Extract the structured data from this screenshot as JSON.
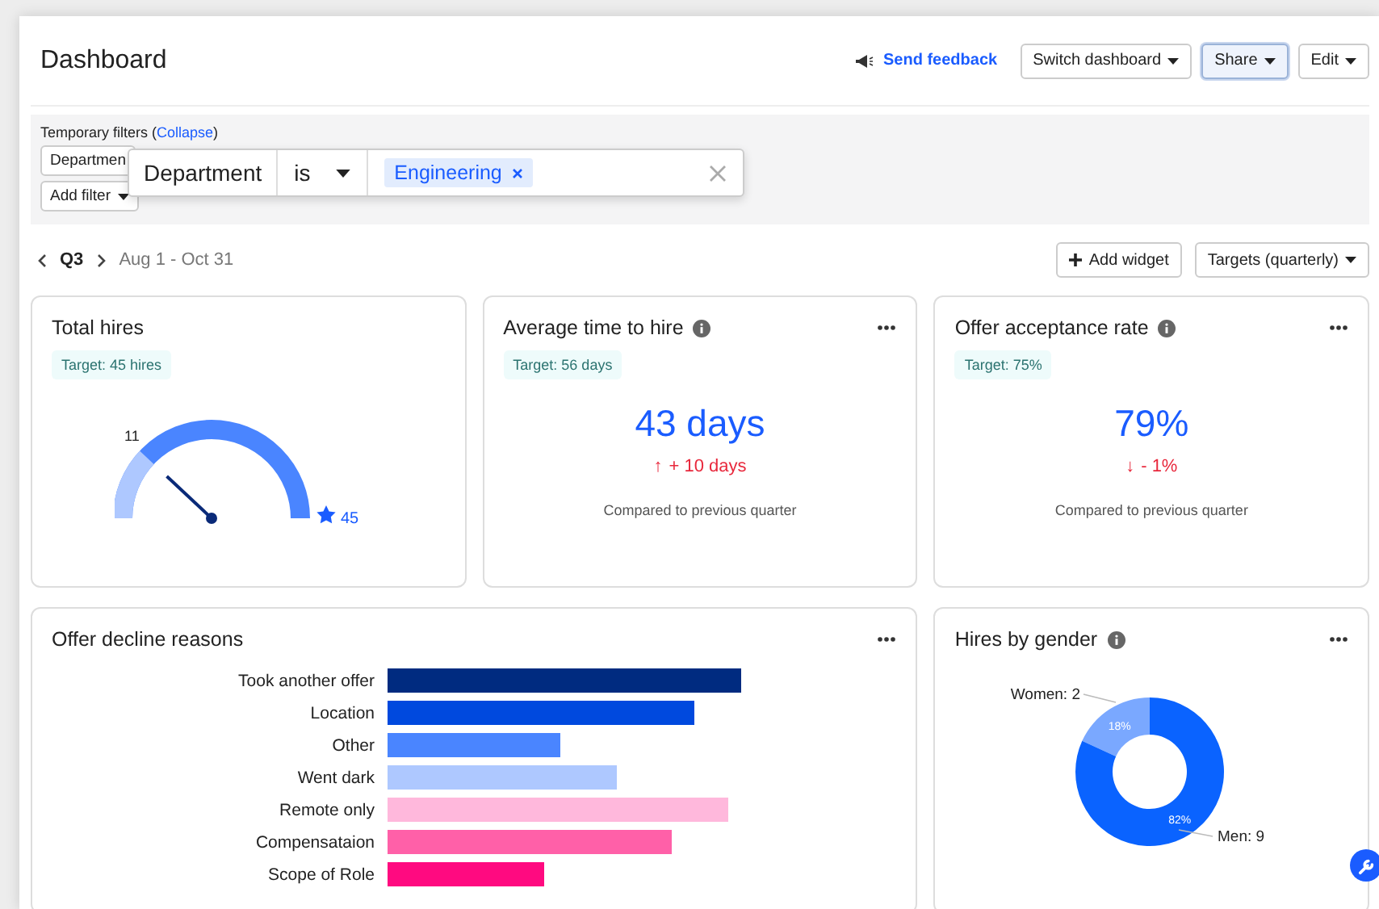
{
  "header": {
    "title": "Dashboard",
    "feedback": "Send feedback",
    "buttons": [
      {
        "label": "Switch dashboard",
        "selected": false
      },
      {
        "label": "Share",
        "selected": true
      },
      {
        "label": "Edit",
        "selected": false
      }
    ]
  },
  "filters": {
    "label": "Temporary filters (",
    "collapse": "Collapse",
    "label_end": ")",
    "chips": [
      "Departmen",
      "Add filter"
    ],
    "popup": {
      "field": "Department",
      "operator": "is",
      "tag": "Engineering"
    }
  },
  "period": {
    "quarter": "Q3",
    "range": "Aug 1 - Oct 31",
    "buttons": [
      "Add widget",
      "Targets (quarterly)"
    ]
  },
  "widgets": [
    {
      "kind": "gauge",
      "title": "Total hires",
      "info": false,
      "menu": false,
      "target": "Target: 45 hires",
      "value_label": "11",
      "target_label": "45"
    },
    {
      "kind": "metric",
      "title": "Average time to hire",
      "info": true,
      "menu": true,
      "target": "Target: 56 days",
      "value": "43 days",
      "arrow": "↑",
      "change": "+ 10 days",
      "note": "Compared to previous quarter"
    },
    {
      "kind": "metric",
      "title": "Offer acceptance rate",
      "info": true,
      "menu": true,
      "target": "Target: 75%",
      "value": "79%",
      "arrow": "↓",
      "change": "- 1%",
      "note": "Compared to previous quarter"
    },
    {
      "kind": "bars",
      "title": "Offer decline reasons",
      "info": false,
      "menu": true,
      "bars": [
        {
          "label": "Took another offer",
          "color": "#002b80"
        },
        {
          "label": "Location",
          "color": "#0049de"
        },
        {
          "label": "Other",
          "color": "#4a85ff"
        },
        {
          "label": "Went dark",
          "color": "#aec8ff"
        },
        {
          "label": "Remote only",
          "color": "#ffb8dc"
        },
        {
          "label": "Compensataion",
          "color": "#ff60a8"
        },
        {
          "label": "Scope of Role",
          "color": "#ff0a80"
        }
      ]
    },
    {
      "kind": "donut",
      "title": "Hires by gender",
      "info": true,
      "menu": true,
      "chart_data": {
        "type": "donut",
        "categories": [
          "Women: 2",
          "Men: 9"
        ],
        "values": [
          2,
          9
        ]
      },
      "percent_labels": [
        "18%",
        "82%"
      ]
    }
  ]
}
